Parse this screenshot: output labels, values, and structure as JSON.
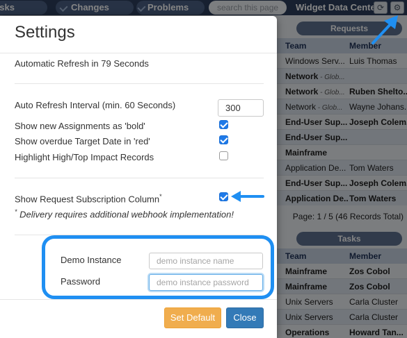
{
  "app": {
    "nav": [
      "asks",
      "Changes",
      "Problems"
    ],
    "search_placeholder": "search this page",
    "title": "Widget Data Center",
    "requests_header": "Requests",
    "tasks_header": "Tasks",
    "columns": [
      "Team",
      "Member"
    ],
    "requests": [
      {
        "team": "Windows Serv...",
        "team_sub": "",
        "member": "Luis Thomas",
        "bold": false
      },
      {
        "team": "Network",
        "team_sub": "- Glob...",
        "member": "",
        "bold": true
      },
      {
        "team": "Network",
        "team_sub": "- Glob...",
        "member": "Ruben Shelto...",
        "bold": true
      },
      {
        "team": "Network",
        "team_sub": "- Glob...",
        "member": "Wayne Johans...",
        "bold": false
      },
      {
        "team": "End-User Sup...",
        "team_sub": "",
        "member": "Joseph Colem...",
        "bold": true
      },
      {
        "team": "End-User Sup...",
        "team_sub": "",
        "member": "",
        "bold": true
      },
      {
        "team": "Mainframe",
        "team_sub": "",
        "member": "",
        "bold": true
      },
      {
        "team": "Application De...",
        "team_sub": "",
        "member": "Tom Waters",
        "bold": false
      },
      {
        "team": "End-User Sup...",
        "team_sub": "",
        "member": "Joseph Colem...",
        "bold": true
      },
      {
        "team": "Application De...",
        "team_sub": "",
        "member": "Tom Waters",
        "bold": true
      }
    ],
    "requests_paging": "Page: 1 / 5 (46 Records Total)",
    "tasks": [
      {
        "team": "Mainframe",
        "member": "Zos Cobol",
        "bold": true
      },
      {
        "team": "Mainframe",
        "member": "Zos Cobol",
        "bold": true
      },
      {
        "team": "Unix Servers",
        "member": "Carla Cluster",
        "bold": false
      },
      {
        "team": "Unix Servers",
        "member": "Carla Cluster",
        "bold": false
      },
      {
        "team": "Operations",
        "member": "Howard Tan...",
        "bold": true
      }
    ]
  },
  "settings": {
    "title": "Settings",
    "auto_refresh_status": "Automatic Refresh in 79 Seconds",
    "interval_label": "Auto Refresh Interval (min. 60 Seconds)",
    "interval_value": "300",
    "opt_bold_label": "Show new Assignments as 'bold'",
    "opt_bold_checked": true,
    "opt_overdue_label": "Show overdue Target Date in 'red'",
    "opt_overdue_checked": true,
    "opt_highlight_label": "Highlight High/Top Impact Records",
    "opt_highlight_checked": false,
    "opt_subscription_label": "Show Request Subscription Column",
    "opt_subscription_marker": "*",
    "opt_subscription_checked": true,
    "note_marker": "*",
    "note_text": " Delivery requires additional webhook implementation!",
    "demo_instance_label": "Demo Instance",
    "demo_instance_placeholder": "demo instance name",
    "password_label": "Password",
    "password_placeholder": "demo instance password",
    "set_default_label": "Set Default",
    "close_label": "Close"
  },
  "colors": {
    "highlight_blue": "#1f8ff2",
    "primary_button": "#337ab7",
    "warning_button": "#f0ad4e"
  }
}
